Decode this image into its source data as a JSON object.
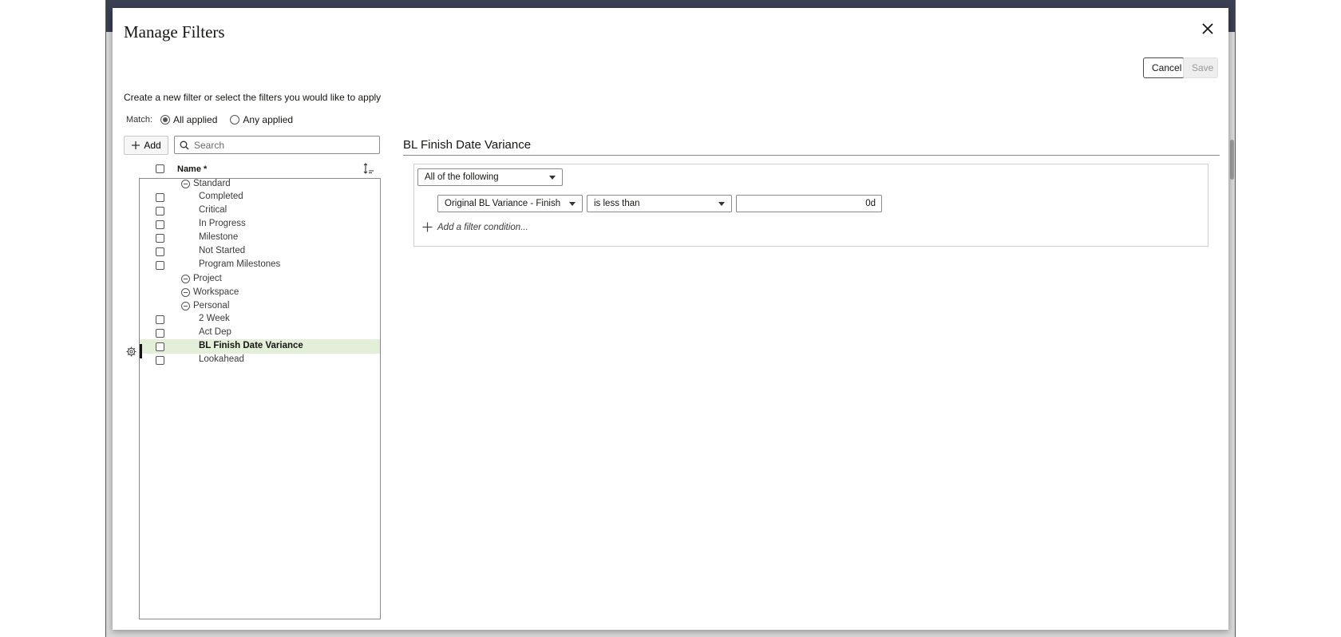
{
  "dialog": {
    "title": "Manage Filters",
    "cancel_label": "Cancel",
    "save_label": "Save",
    "subtitle": "Create a new filter or select the filters you would like to apply"
  },
  "match": {
    "label": "Match:",
    "options": [
      {
        "label": "All applied",
        "checked": true
      },
      {
        "label": "Any applied",
        "checked": false
      }
    ]
  },
  "toolbar": {
    "add_label": "Add",
    "search_placeholder": "Search"
  },
  "list": {
    "header_name": "Name *",
    "groups": [
      {
        "label": "Standard",
        "items": [
          "Completed",
          "Critical",
          "In Progress",
          "Milestone",
          "Not Started",
          "Program Milestones"
        ]
      },
      {
        "label": "Project",
        "items": []
      },
      {
        "label": "Workspace",
        "items": []
      },
      {
        "label": "Personal",
        "items": [
          "2 Week",
          "Act Dep",
          "BL Finish Date Variance",
          "Lookahead"
        ]
      }
    ],
    "selected_item": "BL Finish Date Variance"
  },
  "detail": {
    "title": "BL Finish Date Variance",
    "match_select": "All of the following",
    "condition": {
      "field": "Original BL Variance - Finish",
      "operator": "is less than",
      "value": "0d"
    },
    "add_condition_label": "Add a filter condition..."
  },
  "colors": {
    "selected_row_bg": "#e3efd9",
    "backdrop_topbar": "#3a3f52"
  }
}
